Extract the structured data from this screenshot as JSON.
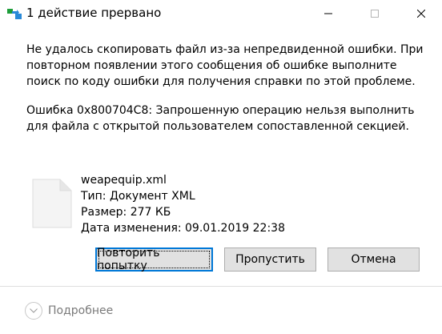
{
  "window": {
    "title": "1 действие прервано",
    "minimize_icon": "minimize-icon",
    "maximize_icon": "maximize-icon",
    "close_icon": "close-icon"
  },
  "message": {
    "text": "Не удалось скопировать файл из-за непредвиденной ошибки. При повторном появлении этого сообщения об ошибке выполните поиск по коду ошибки для получения справки по этой проблеме.",
    "error": "Ошибка 0x800704C8: Запрошенную операцию нельзя выполнить для файла с открытой пользователем сопоставленной секцией."
  },
  "file": {
    "icon": "document-icon",
    "name": "weapequip.xml",
    "type": "Тип: Документ XML",
    "size": "Размер: 277 КБ",
    "modified": "Дата изменения: 09.01.2019 22:38"
  },
  "buttons": {
    "retry": "Повторить попытку",
    "skip": "Пропустить",
    "cancel": "Отмена"
  },
  "footer": {
    "details_label": "Подробнее",
    "details_icon": "chevron-down-icon"
  },
  "colors": {
    "accent": "#0078d7",
    "button_bg": "#e1e1e1",
    "button_border": "#adadad",
    "muted_text": "#7a7a7a"
  }
}
